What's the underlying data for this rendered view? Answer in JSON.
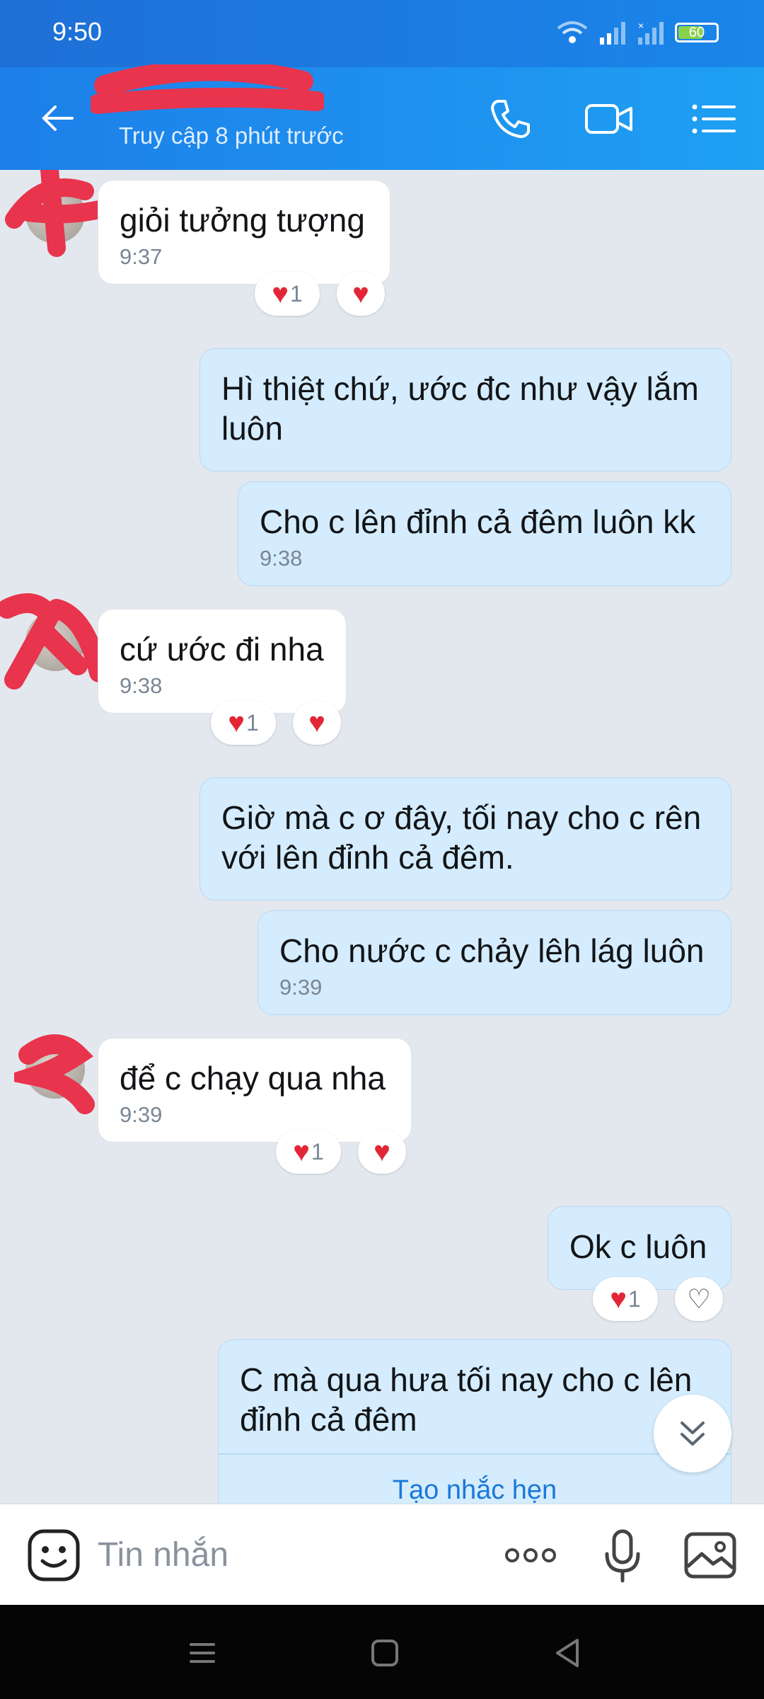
{
  "status_bar": {
    "time": "9:50",
    "battery": "60"
  },
  "header": {
    "contact_name": "",
    "subtitle": "Truy cập 8 phút trước"
  },
  "messages": [
    {
      "side": "in",
      "text": "giỏi tưởng tượng",
      "time": "9:37",
      "reaction_count": "1"
    },
    {
      "side": "out",
      "text": "Hì thiệt chứ, ước đc như vậy lắm luôn",
      "time": ""
    },
    {
      "side": "out",
      "text": "Cho c lên đỉnh cả đêm luôn kk",
      "time": "9:38"
    },
    {
      "side": "in",
      "text": "cứ ước đi nha",
      "time": "9:38",
      "reaction_count": "1"
    },
    {
      "side": "out",
      "text": "Giờ mà c ơ đây, tối nay cho c rên với lên đỉnh cả đêm.",
      "time": ""
    },
    {
      "side": "out",
      "text": "Cho nước c chảy lêh lág luôn",
      "time": "9:39"
    },
    {
      "side": "in",
      "text": "để c chạy qua nha",
      "time": "9:39",
      "reaction_count": "1"
    },
    {
      "side": "out",
      "text": "Ok c luôn",
      "time": "",
      "reaction_count": "1"
    },
    {
      "side": "out",
      "text": "C mà qua hưa tối nay cho c lên đỉnh cả đêm",
      "time": "",
      "action": "Tạo nhắc hẹn"
    }
  ],
  "input": {
    "placeholder": "Tin nhắn"
  },
  "icons": {
    "back": "arrow-left-icon",
    "call": "phone-icon",
    "video": "video-camera-icon",
    "menu": "list-menu-icon",
    "emoji": "emoji-icon",
    "more": "more-dots-icon",
    "mic": "microphone-icon",
    "image": "image-icon",
    "scroll_down": "double-chevron-down-icon"
  },
  "colors": {
    "header": "#1d8ff0",
    "outgoing_bubble": "#d4ecfd",
    "incoming_bubble": "#ffffff",
    "heart": "#e32636",
    "link": "#1a78d9"
  }
}
